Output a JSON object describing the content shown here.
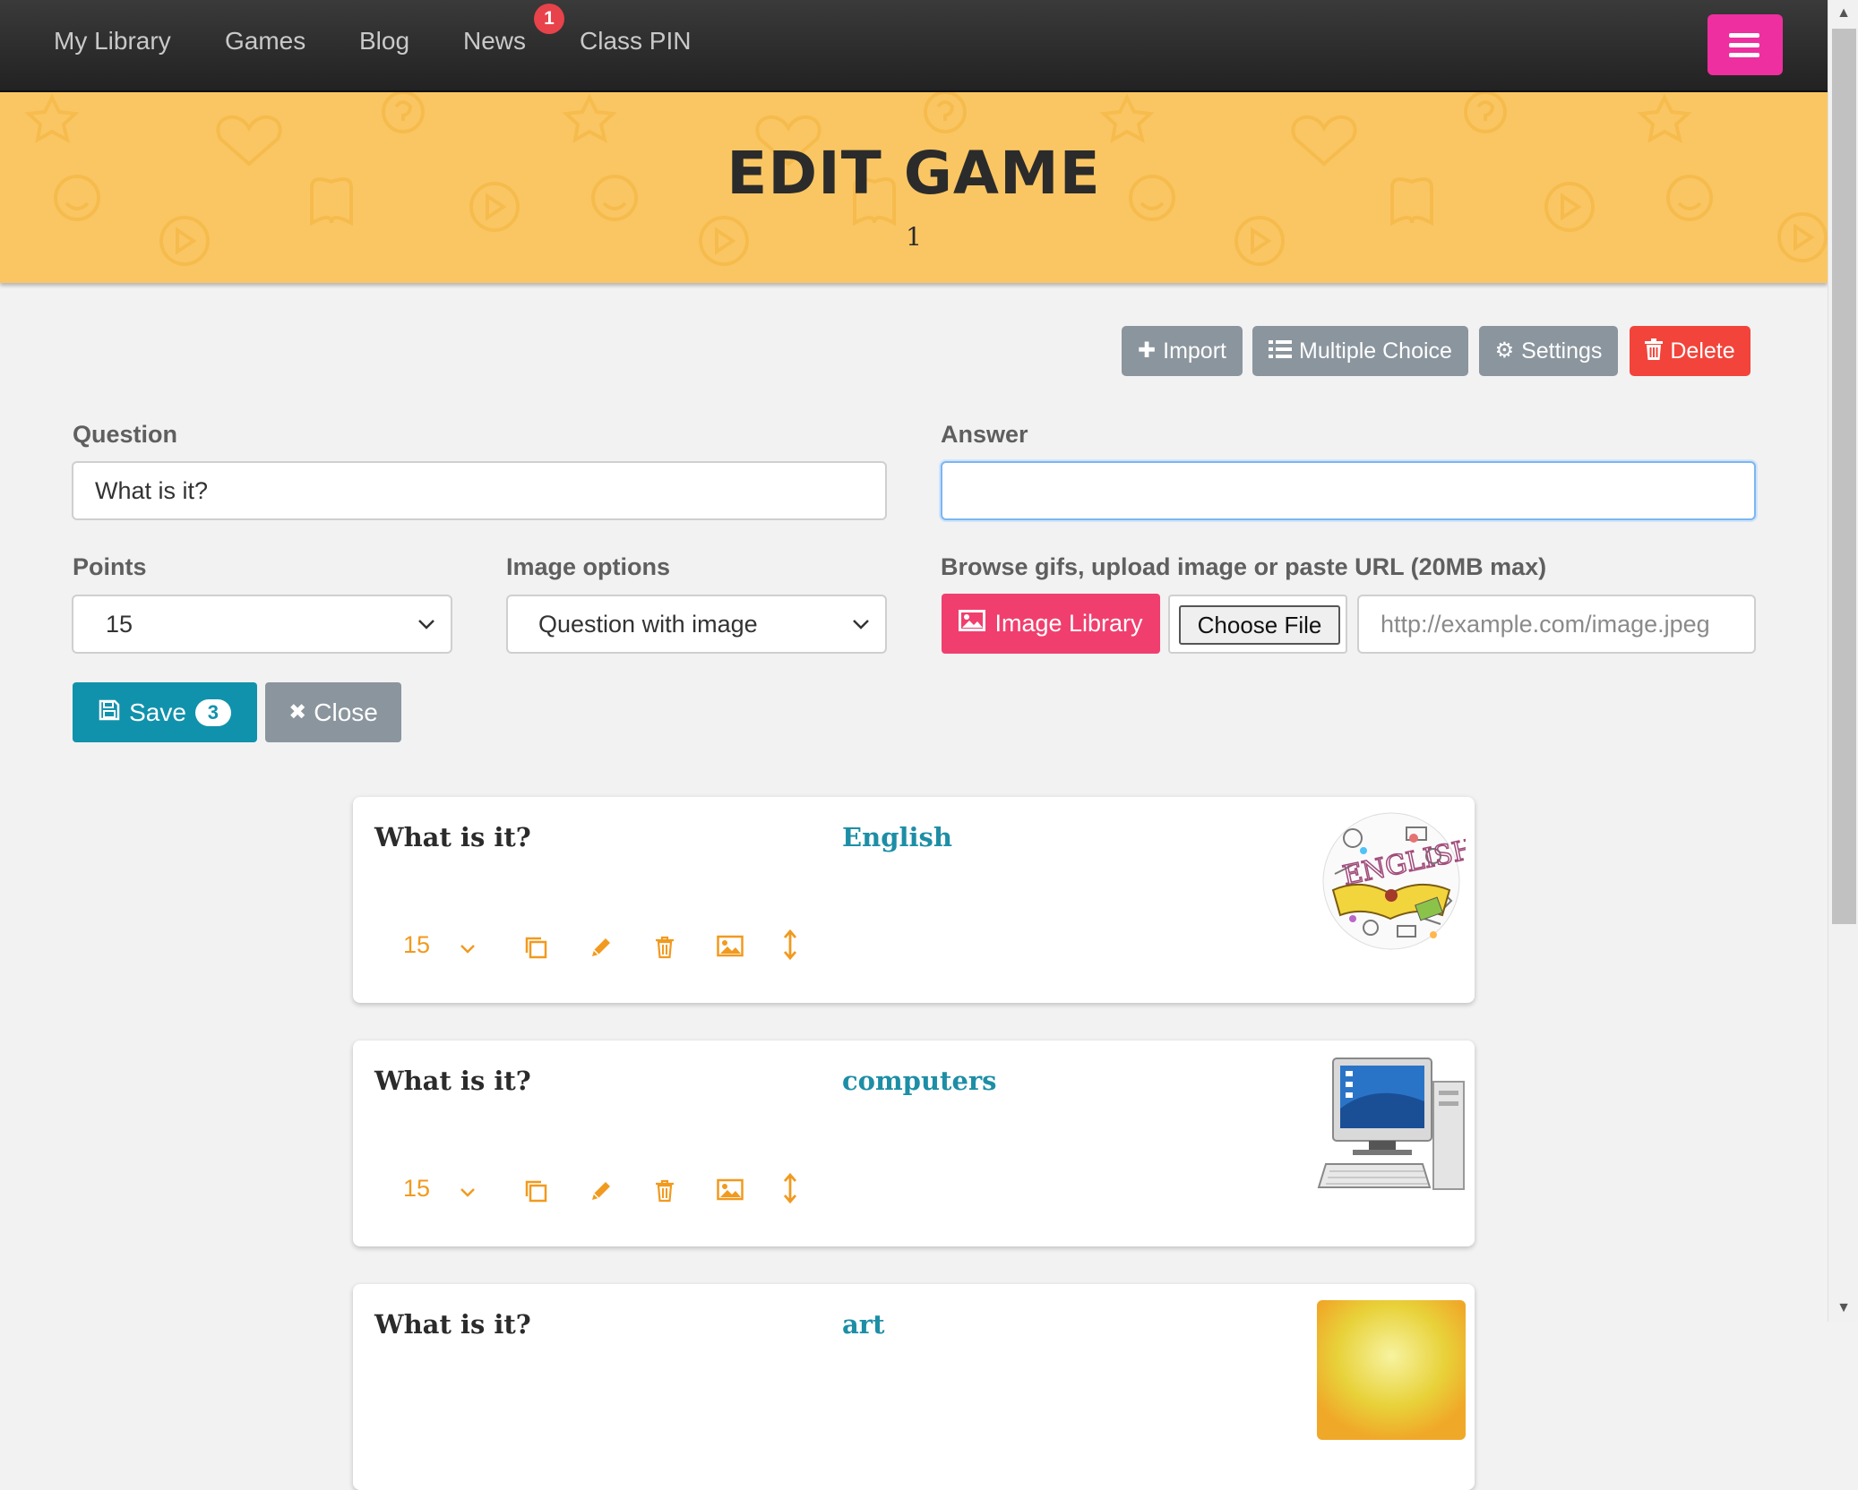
{
  "nav": {
    "links": [
      "My Library",
      "Games",
      "Blog",
      "News",
      "Class PIN"
    ],
    "news_badge": "1",
    "menu_icon": "hamburger-icon",
    "menu_color": "#ee2f9f"
  },
  "hero": {
    "title": "EDIT GAME",
    "subtitle": "1",
    "background": "#fac663"
  },
  "toolbar": {
    "import_label": "Import",
    "multiple_choice_label": "Multiple Choice",
    "settings_label": "Settings",
    "delete_label": "Delete"
  },
  "form": {
    "question_label": "Question",
    "question_value": "What is it?",
    "answer_label": "Answer",
    "answer_value": "",
    "points_label": "Points",
    "points_value": "15",
    "image_options_label": "Image options",
    "image_options_value": "Question with image",
    "browse_label": "Browse gifs, upload image or paste URL (20MB max)",
    "image_library_label": "Image Library",
    "choose_file_label": "Choose File",
    "url_placeholder": "http://example.com/image.jpeg",
    "save_label": "Save",
    "save_count": "3",
    "close_label": "Close"
  },
  "questions": [
    {
      "question": "What is it?",
      "answer": "English",
      "points": "15",
      "image": "english-doodle-image"
    },
    {
      "question": "What is it?",
      "answer": "computers",
      "points": "15",
      "image": "computer-image"
    },
    {
      "question": "What is it?",
      "answer": "art",
      "points": "",
      "image": "art-image"
    }
  ],
  "colors": {
    "accent_blue": "#1192ac",
    "accent_orange": "#f19a1f",
    "danger": "#f2443b",
    "image_library": "#f03f6e"
  }
}
